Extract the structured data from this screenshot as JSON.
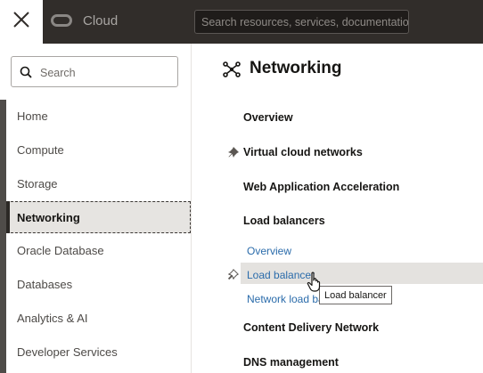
{
  "header": {
    "brand": "Cloud",
    "search_placeholder": "Search resources, services, documentatio"
  },
  "menu": {
    "search_placeholder": "Search",
    "items": [
      {
        "label": "Home"
      },
      {
        "label": "Compute"
      },
      {
        "label": "Storage"
      },
      {
        "label": "Networking",
        "active": true
      },
      {
        "label": "Oracle Database"
      },
      {
        "label": "Databases"
      },
      {
        "label": "Analytics & AI"
      },
      {
        "label": "Developer Services"
      }
    ]
  },
  "networking": {
    "title": "Networking",
    "links": {
      "overview": "Overview",
      "vcn": "Virtual cloud networks",
      "waa": "Web Application Acceleration",
      "load_balancers": "Load balancers",
      "lb_overview": "Overview",
      "lb_load_balancer": "Load balancer",
      "lb_network": "Network load bal",
      "cdn": "Content Delivery Network",
      "dns": "DNS management"
    }
  },
  "tooltip": "Load balancer",
  "colors": {
    "topbar": "#312d2a",
    "link": "#2b6cab",
    "active_bg": "#e6e4e1"
  }
}
